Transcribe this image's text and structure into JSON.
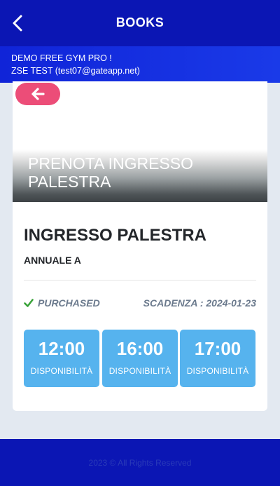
{
  "header": {
    "title": "BOOKS",
    "back_icon": "chevron-left-icon"
  },
  "subheader": {
    "gym_name": "DEMO FREE GYM PRO !",
    "user_line": "ZSE TEST (test07@gateapp.net)"
  },
  "card": {
    "back_icon": "arrow-left-icon",
    "banner_title": "PRENOTA INGRESSO PALESTRA",
    "product_title": "INGRESSO PALESTRA",
    "product_subtitle": "ANNUALE A",
    "status_label": "PURCHASED",
    "expiry_label": "SCADENZA : 2024-01-23",
    "slots": [
      {
        "time": "12:00",
        "label": "DISPONIBILITÀ"
      },
      {
        "time": "16:00",
        "label": "DISPONIBILITÀ"
      },
      {
        "time": "17:00",
        "label": "DISPONIBILITÀ"
      }
    ]
  },
  "footer": {
    "text": "2023 © All Rights Reserved"
  },
  "colors": {
    "primary": "#0b16b4",
    "accent_pink": "#ec4d78",
    "slot_blue": "#56b3ee",
    "status_green": "#3aa33a"
  }
}
